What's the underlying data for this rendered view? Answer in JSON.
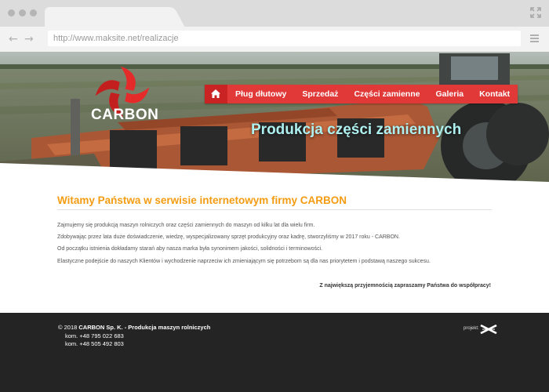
{
  "browser": {
    "url": "http://www.maksite.net/realizacje"
  },
  "site": {
    "logo_text": "CARBON",
    "nav": [
      "Pług dłutowy",
      "Sprzedaż",
      "Części zamienne",
      "Galeria",
      "Kontakt"
    ],
    "hero_title": "Produkcja części zamiennych"
  },
  "content": {
    "heading": "Witamy Państwa w serwisie internetowym firmy CARBON",
    "paragraphs": [
      "Zajmujemy się produkcją maszyn rolniczych oraz części zamiennych do maszyn od kilku lat dla wielu firm.",
      "Zdobywając przez lata duże doświadczenie, wiedzę, wyspecjalizowany sprzęt produkcyjny oraz kadrę, stworzyliśmy w 2017 roku - CARBON.",
      "Od początku istnienia dokładamy starań aby nasza marka była synonimem jakości, solidności i terminowości.",
      "Elastyczne podejście do naszych Klientów i wychodzenie naprzeciw ich zmieniającym się potrzebom są dla nas priorytetem i podstawą naszego sukcesu."
    ],
    "closing": "Z największą przyjemnością zapraszamy Państwa do współpracy!"
  },
  "footer": {
    "copyright_prefix": "© 2018",
    "company": "CARBON Sp. K. - Produkcja maszyn rolniczych",
    "phones": [
      "kom. +48 795 022 683",
      "kom. +48 505 492 803"
    ],
    "credit": "projekt:"
  },
  "colors": {
    "accent_red": "#e13838",
    "heading_orange": "#f39c12",
    "hero_title": "#aef0ef",
    "footer_bg": "#242424"
  },
  "icons": [
    "expand-icon",
    "back-arrow-icon",
    "forward-arrow-icon",
    "hamburger-menu-icon",
    "home-icon",
    "carbon-logo-icon",
    "maksite-logo-icon"
  ]
}
